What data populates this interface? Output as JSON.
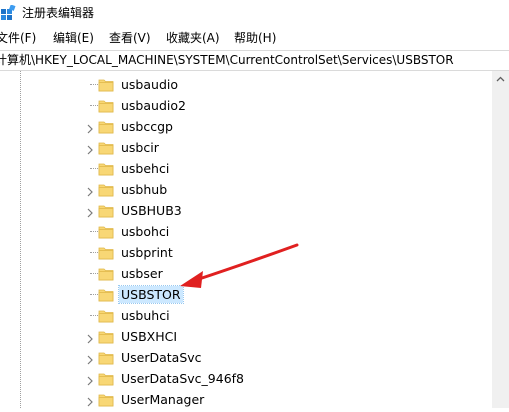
{
  "window": {
    "title": "注册表编辑器"
  },
  "menu": {
    "items": [
      "文件(F)",
      "编辑(E)",
      "查看(V)",
      "收藏夹(A)",
      "帮助(H)"
    ]
  },
  "address": {
    "path": "计算机\\HKEY_LOCAL_MACHINE\\SYSTEM\\CurrentControlSet\\Services\\USBSTOR"
  },
  "tree": {
    "items": [
      {
        "label": "usbaudio",
        "expandable": false,
        "selected": false
      },
      {
        "label": "usbaudio2",
        "expandable": false,
        "selected": false
      },
      {
        "label": "usbccgp",
        "expandable": true,
        "selected": false
      },
      {
        "label": "usbcir",
        "expandable": true,
        "selected": false
      },
      {
        "label": "usbehci",
        "expandable": false,
        "selected": false
      },
      {
        "label": "usbhub",
        "expandable": true,
        "selected": false
      },
      {
        "label": "USBHUB3",
        "expandable": true,
        "selected": false
      },
      {
        "label": "usbohci",
        "expandable": false,
        "selected": false
      },
      {
        "label": "usbprint",
        "expandable": false,
        "selected": false
      },
      {
        "label": "usbser",
        "expandable": false,
        "selected": false
      },
      {
        "label": "USBSTOR",
        "expandable": false,
        "selected": true
      },
      {
        "label": "usbuhci",
        "expandable": false,
        "selected": false
      },
      {
        "label": "USBXHCI",
        "expandable": true,
        "selected": false
      },
      {
        "label": "UserDataSvc",
        "expandable": true,
        "selected": false
      },
      {
        "label": "UserDataSvc_946f8",
        "expandable": true,
        "selected": false
      },
      {
        "label": "UserManager",
        "expandable": true,
        "selected": false
      }
    ]
  },
  "colors": {
    "folder_fill": "#f8d775",
    "folder_edge": "#e0b84a",
    "selection": "#cce8ff",
    "annotation_arrow": "#e02020"
  },
  "icons": {
    "app": "registry-editor-icon",
    "folder": "folder-icon",
    "expander": "chevron-right-icon",
    "scroll_up": "chevron-up-icon"
  }
}
